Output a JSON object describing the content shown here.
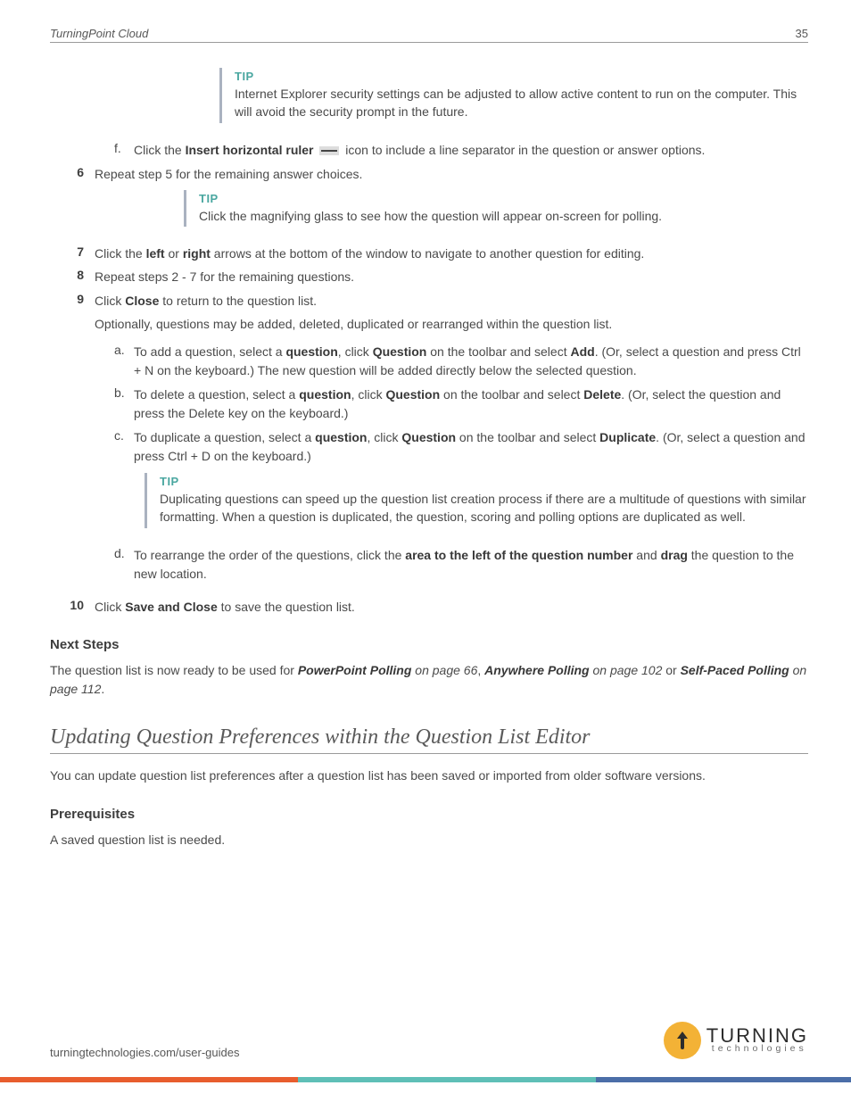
{
  "header": {
    "title": "TurningPoint Cloud",
    "page_number": "35"
  },
  "tips": {
    "label": "TIP",
    "ie_security": "Internet Explorer security settings can be adjusted to allow active content to run on the computer. This will avoid the security prompt in the future.",
    "magnifier": "Click the magnifying glass to see how the question will appear on-screen for polling.",
    "duplicate": "Duplicating questions can speed up the question list creation process if there are a multitude of questions with similar formatting. When a question is duplicated, the question, scoring and polling options are duplicated as well."
  },
  "sub_f": {
    "letter": "f.",
    "pre": "Click the ",
    "bold": "Insert horizontal ruler",
    "post": " icon to include a line separator in the question or answer options."
  },
  "steps": {
    "s6": {
      "num": "6",
      "text": "Repeat step 5 for the remaining answer choices."
    },
    "s7": {
      "num": "7",
      "pre": "Click the ",
      "left": "left",
      "mid": " or ",
      "right": "right",
      "post": " arrows at the bottom of the window to navigate to another question for editing."
    },
    "s8": {
      "num": "8",
      "text": "Repeat steps 2 - 7 for the remaining questions."
    },
    "s9": {
      "num": "9",
      "pre": "Click ",
      "close": "Close",
      "post": " to return to the question list."
    },
    "s10": {
      "num": "10",
      "pre": "Click ",
      "save": "Save and Close",
      "post": " to save the question list."
    }
  },
  "note_optional": "Optionally, questions may be added, deleted, duplicated or rearranged within the question list.",
  "sub_a": {
    "letter": "a.",
    "text1": "To add a question, select a ",
    "b1": "question",
    "text2": ", click ",
    "b2": "Question",
    "text3": " on the toolbar and select ",
    "b3": "Add",
    "text4": ". (Or, select a question and press Ctrl + N on the keyboard.) The new question will be added directly below the selected question."
  },
  "sub_b": {
    "letter": "b.",
    "text1": "To delete a question, select a ",
    "b1": "question",
    "text2": ", click ",
    "b2": "Question",
    "text3": " on the toolbar and select ",
    "b3": "Delete",
    "text4": ". (Or, select the question and press the Delete key on the keyboard.)"
  },
  "sub_c": {
    "letter": "c.",
    "text1": "To duplicate a question, select a ",
    "b1": "question",
    "text2": ", click ",
    "b2": "Question",
    "text3": " on the toolbar and select ",
    "b3": "Duplicate",
    "text4": ". (Or, select a question and press Ctrl + D on the keyboard.)"
  },
  "sub_d": {
    "letter": "d.",
    "text1": "To rearrange the order of the questions, click the ",
    "b1": "area to the left of the question number",
    "text2": " and ",
    "b2": "drag",
    "text3": " the question to the new location."
  },
  "next_steps": {
    "heading": "Next Steps",
    "pre": "The question list is now ready to be used for ",
    "l1": "PowerPoint Polling",
    "p1": " on page 66",
    "comma": ", ",
    "l2": "Anywhere Polling",
    "p2": " on page 102",
    "or": " or ",
    "l3": "Self-Paced Polling",
    "p3": " on page 112",
    "period": "."
  },
  "section": {
    "title": "Updating Question Preferences within the Question List Editor",
    "intro": "You can update question list preferences after a question list has been saved or imported from older software versions."
  },
  "prereq": {
    "heading": "Prerequisites",
    "text": "A saved question list is needed."
  },
  "footer": {
    "url": "turningtechnologies.com/user-guides",
    "logo_big": "TURNING",
    "logo_small": "technologies"
  }
}
